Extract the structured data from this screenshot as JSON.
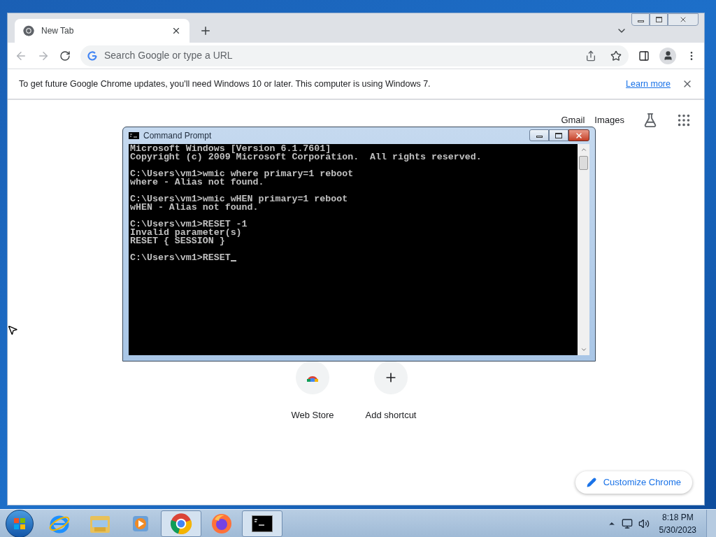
{
  "browser": {
    "tab": {
      "title": "New Tab",
      "selected": true
    },
    "address_bar": {
      "placeholder": "Search Google or type a URL"
    },
    "infobar": {
      "message": "To get future Google Chrome updates, you'll need Windows 10 or later. This computer is using Windows 7.",
      "link": "Learn more"
    },
    "top_links": [
      "Gmail",
      "Images"
    ],
    "shortcuts": [
      {
        "kind": "webstore",
        "label": "Web Store"
      },
      {
        "kind": "add",
        "label": "Add shortcut"
      }
    ],
    "customize_button": "Customize Chrome"
  },
  "console": {
    "title": "Command Prompt",
    "blocks": [
      [
        "Microsoft Windows [Version 6.1.7601]",
        "Copyright (c) 2009 Microsoft Corporation.  All rights reserved."
      ],
      [
        "C:\\Users\\vm1>wmic where primary=1 reboot",
        "where - Alias not found."
      ],
      [
        "C:\\Users\\vm1>wmic wHEN primary=1 reboot",
        "wHEN - Alias not found."
      ],
      [
        "C:\\Users\\vm1>RESET -1",
        "Invalid parameter(s)",
        "RESET { SESSION }"
      ],
      [
        "C:\\Users\\vm1>RESET"
      ]
    ]
  },
  "taskbar": {
    "items": [
      {
        "kind": "ie",
        "running": false
      },
      {
        "kind": "explorer",
        "running": false
      },
      {
        "kind": "media",
        "running": false
      },
      {
        "kind": "chrome",
        "running": true
      },
      {
        "kind": "firefox",
        "running": false
      },
      {
        "kind": "console",
        "running": true
      }
    ],
    "time": "8:18 PM",
    "date": "5/30/2023"
  }
}
